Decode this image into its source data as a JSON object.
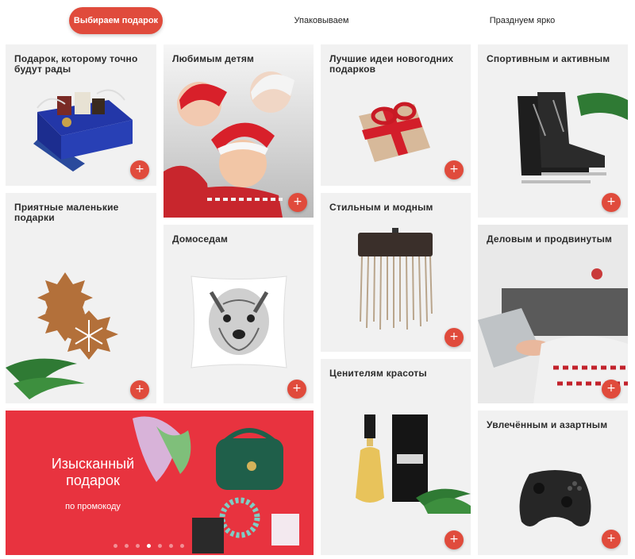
{
  "tabs": [
    {
      "label": "Выбираем подарок",
      "active": true
    },
    {
      "label": "Упаковываем",
      "active": false
    },
    {
      "label": "Празднуем ярко",
      "active": false
    }
  ],
  "cards": {
    "gift_box": {
      "title": "Подарок, которому точно будут рады",
      "button": "+"
    },
    "small": {
      "title": "Приятные маленькие подарки",
      "button": "+"
    },
    "kids": {
      "title": "Любимым детям",
      "button": "+"
    },
    "homebody": {
      "title": "Домоседам",
      "button": "+"
    },
    "ny_ideas": {
      "title": "Лучшие идеи новогодних подарков",
      "button": "+"
    },
    "stylish": {
      "title": "Стильным и модным",
      "button": "+"
    },
    "beauty": {
      "title": "Ценителям красоты",
      "button": "+"
    },
    "sport": {
      "title": "Спортивным и активным",
      "button": "+"
    },
    "business": {
      "title": "Деловым и продвинутым",
      "button": "+"
    },
    "gamers": {
      "title": "Увлечённым и азартным",
      "button": "+"
    }
  },
  "promo": {
    "title": "Изысканный подарок",
    "subtitle": "по промокоду",
    "slides": 7,
    "active_slide": 4
  },
  "colors": {
    "accent": "#e04b3c",
    "promo_bg": "#e8333f",
    "card_bg": "#f1f1f1"
  }
}
